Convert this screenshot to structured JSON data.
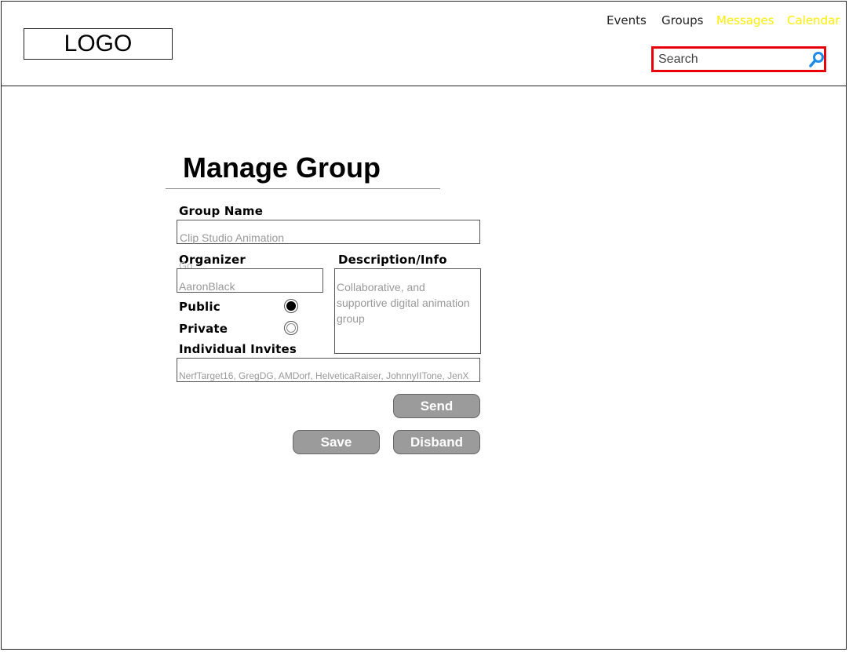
{
  "header": {
    "logo_text": "LOGO",
    "nav": [
      {
        "label": "Events",
        "color": "#222222"
      },
      {
        "label": "Groups",
        "color": "#222222"
      },
      {
        "label": "Messages",
        "color": "#ffee00"
      },
      {
        "label": "Calendar",
        "color": "#ffee00"
      }
    ],
    "search": {
      "placeholder": "Search",
      "value": "",
      "icon": "search-icon",
      "highlight_color": "#e8000b",
      "icon_color": "#1f8be8"
    }
  },
  "form": {
    "title": "Manage Group",
    "group_name": {
      "label": "Group Name",
      "value": "Clip Studio Animation"
    },
    "organizer": {
      "label": "Organizer",
      "ghost_text": "Go",
      "value": "AaronBlack"
    },
    "description": {
      "label": "Description/Info",
      "value": "Collaborative, and supportive digital animation group"
    },
    "visibility": {
      "public": {
        "label": "Public",
        "selected": true
      },
      "private": {
        "label": "Private",
        "selected": false
      }
    },
    "invites": {
      "label": "Individual Invites",
      "value": "NerfTarget16, GregDG, AMDorf, HelveticaRaiser, JohnnyIITone, JenX"
    },
    "buttons": {
      "send": "Send",
      "save": "Save",
      "disband": "Disband"
    },
    "button_color": "#9b9b9b"
  }
}
